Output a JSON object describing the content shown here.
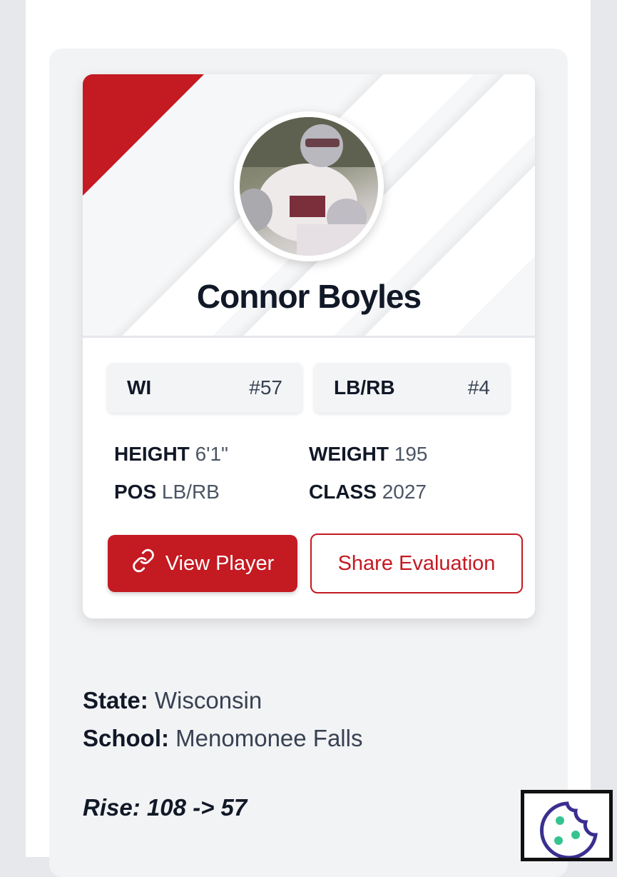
{
  "player": {
    "name": "Connor Boyles",
    "state_code": "WI",
    "state_rank": "#57",
    "position_label": "LB/RB",
    "position_rank": "#4"
  },
  "stats": [
    {
      "label": "HEIGHT",
      "value": "6'1\""
    },
    {
      "label": "WEIGHT",
      "value": "195"
    },
    {
      "label": "POS",
      "value": "LB/RB"
    },
    {
      "label": "CLASS",
      "value": "2027"
    }
  ],
  "actions": {
    "view_player": "View Player",
    "share_evaluation": "Share Evaluation"
  },
  "details": {
    "state_label": "State:",
    "state_value": "Wisconsin",
    "school_label": "School:",
    "school_value": "Menomonee Falls"
  },
  "rise_text": "Rise: 108 -> 57",
  "icons": {
    "link": "link-icon",
    "cookie": "cookie-icon"
  },
  "colors": {
    "brand_red": "#c41a22",
    "text_dark": "#111827",
    "cookie_dots": "#35c48f",
    "cookie_outline": "#3a2f8f"
  }
}
